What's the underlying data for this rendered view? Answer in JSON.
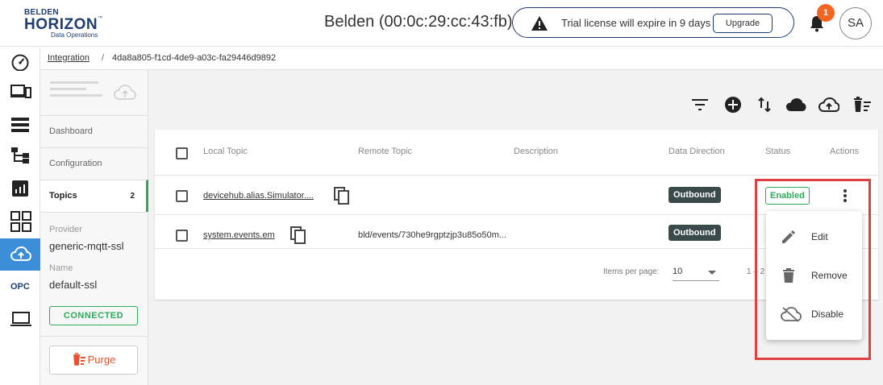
{
  "header": {
    "logo_line1": "BELDEN",
    "logo_line2": "HORIZON",
    "logo_tm": "™",
    "logo_line3": "Data Operations",
    "device_title": "Belden (00:0c:29:cc:43:fb)",
    "trial_message": "Trial license will expire in 9 days",
    "upgrade_label": "Upgrade",
    "notification_count": "1",
    "avatar_initials": "SA"
  },
  "nav": {
    "opc_label": "OPC",
    "active_color": "#3d8ed9"
  },
  "breadcrumb": {
    "parent": "Integration",
    "separator": "/",
    "current": "4da8a805-f1cd-4de9-a03c-fa29446d9892"
  },
  "side": {
    "tabs": [
      {
        "label": "Dashboard"
      },
      {
        "label": "Configuration"
      },
      {
        "label": "Topics",
        "count": "2"
      }
    ],
    "provider_label": "Provider",
    "provider_value": "generic-mqtt-ssl",
    "name_label": "Name",
    "name_value": "default-ssl",
    "status": "CONNECTED",
    "purge_label": "Purge"
  },
  "table": {
    "headers": {
      "local_topic": "Local Topic",
      "remote_topic": "Remote Topic",
      "description": "Description",
      "data_direction": "Data Direction",
      "status": "Status",
      "actions": "Actions"
    },
    "rows": [
      {
        "local_topic": "devicehub.alias.Simulator....",
        "remote_topic": "",
        "description": "",
        "direction": "Outbound",
        "status": "Enabled"
      },
      {
        "local_topic": "system.events.em",
        "remote_topic": "bld/events/730he9rgptzjp3u85o50m...",
        "description": "",
        "direction": "Outbound",
        "status": ""
      }
    ],
    "paginator": {
      "items_per_page_label": "Items per page:",
      "items_per_page_value": "10",
      "range": "1 – 2"
    }
  },
  "context_menu": {
    "items": [
      {
        "label": "Edit",
        "icon": "pencil-icon"
      },
      {
        "label": "Remove",
        "icon": "trash-icon"
      },
      {
        "label": "Disable",
        "icon": "cloud-off-icon"
      }
    ]
  },
  "colors": {
    "brand": "#1e3d73",
    "success": "#2eaa5c",
    "danger": "#e8502e",
    "badge": "#f26522",
    "highlight": "#e04040"
  }
}
